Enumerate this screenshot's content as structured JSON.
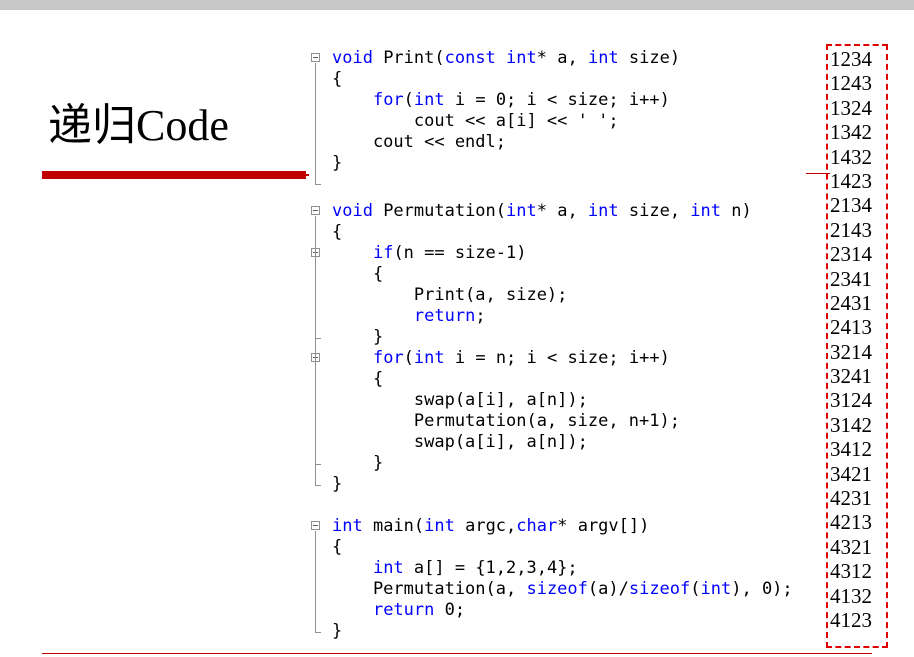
{
  "slide": {
    "title": "递归Code"
  },
  "code": {
    "lines": [
      [
        {
          "t": "void",
          "k": 1
        },
        {
          "t": " Print("
        },
        {
          "t": "const",
          "k": 1
        },
        {
          "t": " "
        },
        {
          "t": "int",
          "k": 1
        },
        {
          "t": "* a, "
        },
        {
          "t": "int",
          "k": 1
        },
        {
          "t": " size)"
        }
      ],
      [
        {
          "t": "{"
        }
      ],
      [
        {
          "t": "    "
        },
        {
          "t": "for",
          "k": 1
        },
        {
          "t": "("
        },
        {
          "t": "int",
          "k": 1
        },
        {
          "t": " i = 0; i < size; i++)"
        }
      ],
      [
        {
          "t": "        cout << a[i] << ' ';"
        }
      ],
      [
        {
          "t": "    cout << endl;"
        }
      ],
      [
        {
          "t": "}"
        }
      ],
      [
        {
          "t": ""
        }
      ],
      [
        {
          "t": "void",
          "k": 1
        },
        {
          "t": " Permutation("
        },
        {
          "t": "int",
          "k": 1
        },
        {
          "t": "* a, "
        },
        {
          "t": "int",
          "k": 1
        },
        {
          "t": " size, "
        },
        {
          "t": "int",
          "k": 1
        },
        {
          "t": " n)"
        }
      ],
      [
        {
          "t": "{"
        }
      ],
      [
        {
          "t": "    "
        },
        {
          "t": "if",
          "k": 1
        },
        {
          "t": "(n == size-1)"
        }
      ],
      [
        {
          "t": "    {"
        }
      ],
      [
        {
          "t": "        Print(a, size);"
        }
      ],
      [
        {
          "t": "        "
        },
        {
          "t": "return",
          "k": 1
        },
        {
          "t": ";"
        }
      ],
      [
        {
          "t": "    }"
        }
      ],
      [
        {
          "t": "    "
        },
        {
          "t": "for",
          "k": 1
        },
        {
          "t": "("
        },
        {
          "t": "int",
          "k": 1
        },
        {
          "t": " i = n; i < size; i++)"
        }
      ],
      [
        {
          "t": "    {"
        }
      ],
      [
        {
          "t": "        swap(a[i], a[n]);"
        }
      ],
      [
        {
          "t": "        Permutation(a, size, n+1);"
        }
      ],
      [
        {
          "t": "        swap(a[i], a[n]);"
        }
      ],
      [
        {
          "t": "    }"
        }
      ],
      [
        {
          "t": "}"
        }
      ],
      [
        {
          "t": ""
        }
      ],
      [
        {
          "t": "int",
          "k": 1
        },
        {
          "t": " main("
        },
        {
          "t": "int",
          "k": 1
        },
        {
          "t": " argc,"
        },
        {
          "t": "char",
          "k": 1
        },
        {
          "t": "* argv[])"
        }
      ],
      [
        {
          "t": "{"
        }
      ],
      [
        {
          "t": "    "
        },
        {
          "t": "int",
          "k": 1
        },
        {
          "t": " a[] = {1,2,3,4};"
        }
      ],
      [
        {
          "t": "    Permutation(a, "
        },
        {
          "t": "sizeof",
          "k": 1
        },
        {
          "t": "(a)/"
        },
        {
          "t": "sizeof",
          "k": 1
        },
        {
          "t": "("
        },
        {
          "t": "int",
          "k": 1
        },
        {
          "t": "), 0);"
        }
      ],
      [
        {
          "t": "    "
        },
        {
          "t": "return",
          "k": 1
        },
        {
          "t": " 0;"
        }
      ],
      [
        {
          "t": "}"
        }
      ]
    ]
  },
  "permutations": [
    "1234",
    "1243",
    "1324",
    "1342",
    "1432",
    "1423",
    "2134",
    "2143",
    "2314",
    "2341",
    "2431",
    "2413",
    "3214",
    "3241",
    "3124",
    "3142",
    "3412",
    "3421",
    "4231",
    "4213",
    "4321",
    "4312",
    "4132",
    "4123"
  ],
  "colors": {
    "keyword": "#0000ff",
    "accent_red": "#c00000",
    "dashed_border": "#e00000"
  }
}
